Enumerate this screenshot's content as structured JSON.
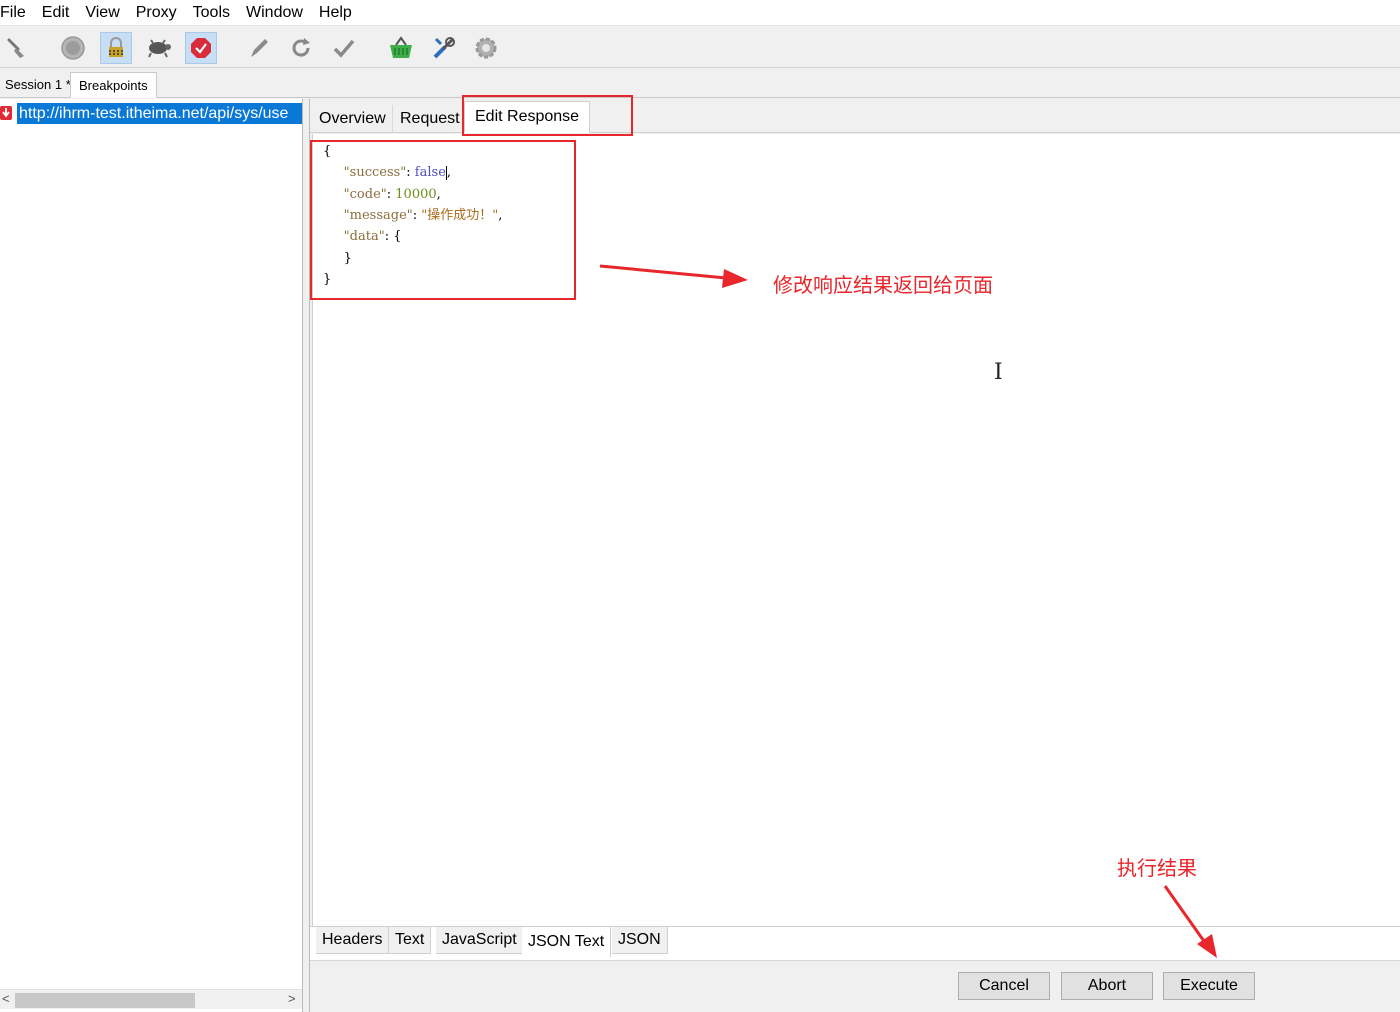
{
  "menu": [
    "File",
    "Edit",
    "View",
    "Proxy",
    "Tools",
    "Window",
    "Help"
  ],
  "toolbar_icons": [
    "broom-icon",
    "record-icon",
    "lock-icon",
    "turtle-icon",
    "stop-icon",
    "pen-icon",
    "refresh-icon",
    "check-icon",
    "basket-icon",
    "tools-icon",
    "gear-icon"
  ],
  "session_tabs": [
    "Session 1 *",
    "Breakpoints"
  ],
  "sessions": [
    {
      "url": "http://ihrm-test.itheima.net/api/sys/use"
    }
  ],
  "inspector_tabs": [
    "Overview",
    "Request",
    "Edit Response"
  ],
  "editor_lines": [
    {
      "indent": "",
      "parts": [
        {
          "t": "{",
          "c": ""
        }
      ]
    },
    {
      "indent": "     ",
      "parts": [
        {
          "t": "\"success\"",
          "c": "k"
        },
        {
          "t": ": ",
          "c": ""
        },
        {
          "t": "false",
          "c": "b"
        },
        {
          "t": "|",
          "c": "caret"
        },
        {
          "t": ",",
          "c": ""
        }
      ]
    },
    {
      "indent": "     ",
      "parts": [
        {
          "t": "\"code\"",
          "c": "k"
        },
        {
          "t": ": ",
          "c": ""
        },
        {
          "t": "10000",
          "c": "n"
        },
        {
          "t": ",",
          "c": ""
        }
      ]
    },
    {
      "indent": "     ",
      "parts": [
        {
          "t": "\"message\"",
          "c": "k"
        },
        {
          "t": ": ",
          "c": ""
        },
        {
          "t": "\"操作成功！\"",
          "c": "s"
        },
        {
          "t": ",",
          "c": ""
        }
      ]
    },
    {
      "indent": "     ",
      "parts": [
        {
          "t": "\"data\"",
          "c": "k"
        },
        {
          "t": ": {",
          "c": ""
        }
      ]
    },
    {
      "indent": "     ",
      "parts": [
        {
          "t": "}",
          "c": ""
        }
      ]
    },
    {
      "indent": "",
      "parts": [
        {
          "t": "}",
          "c": ""
        }
      ]
    }
  ],
  "bottom_tabs": [
    "Headers",
    "Text",
    "JavaScript",
    "JSON Text",
    "JSON"
  ],
  "buttons": {
    "cancel": "Cancel",
    "abort": "Abort",
    "execute": "Execute"
  },
  "annotations": {
    "modify_note": "修改响应结果返回给页面",
    "execute_note": "执行结果"
  },
  "colors": {
    "accent": "#e8262b",
    "selection": "#0a78d7"
  }
}
